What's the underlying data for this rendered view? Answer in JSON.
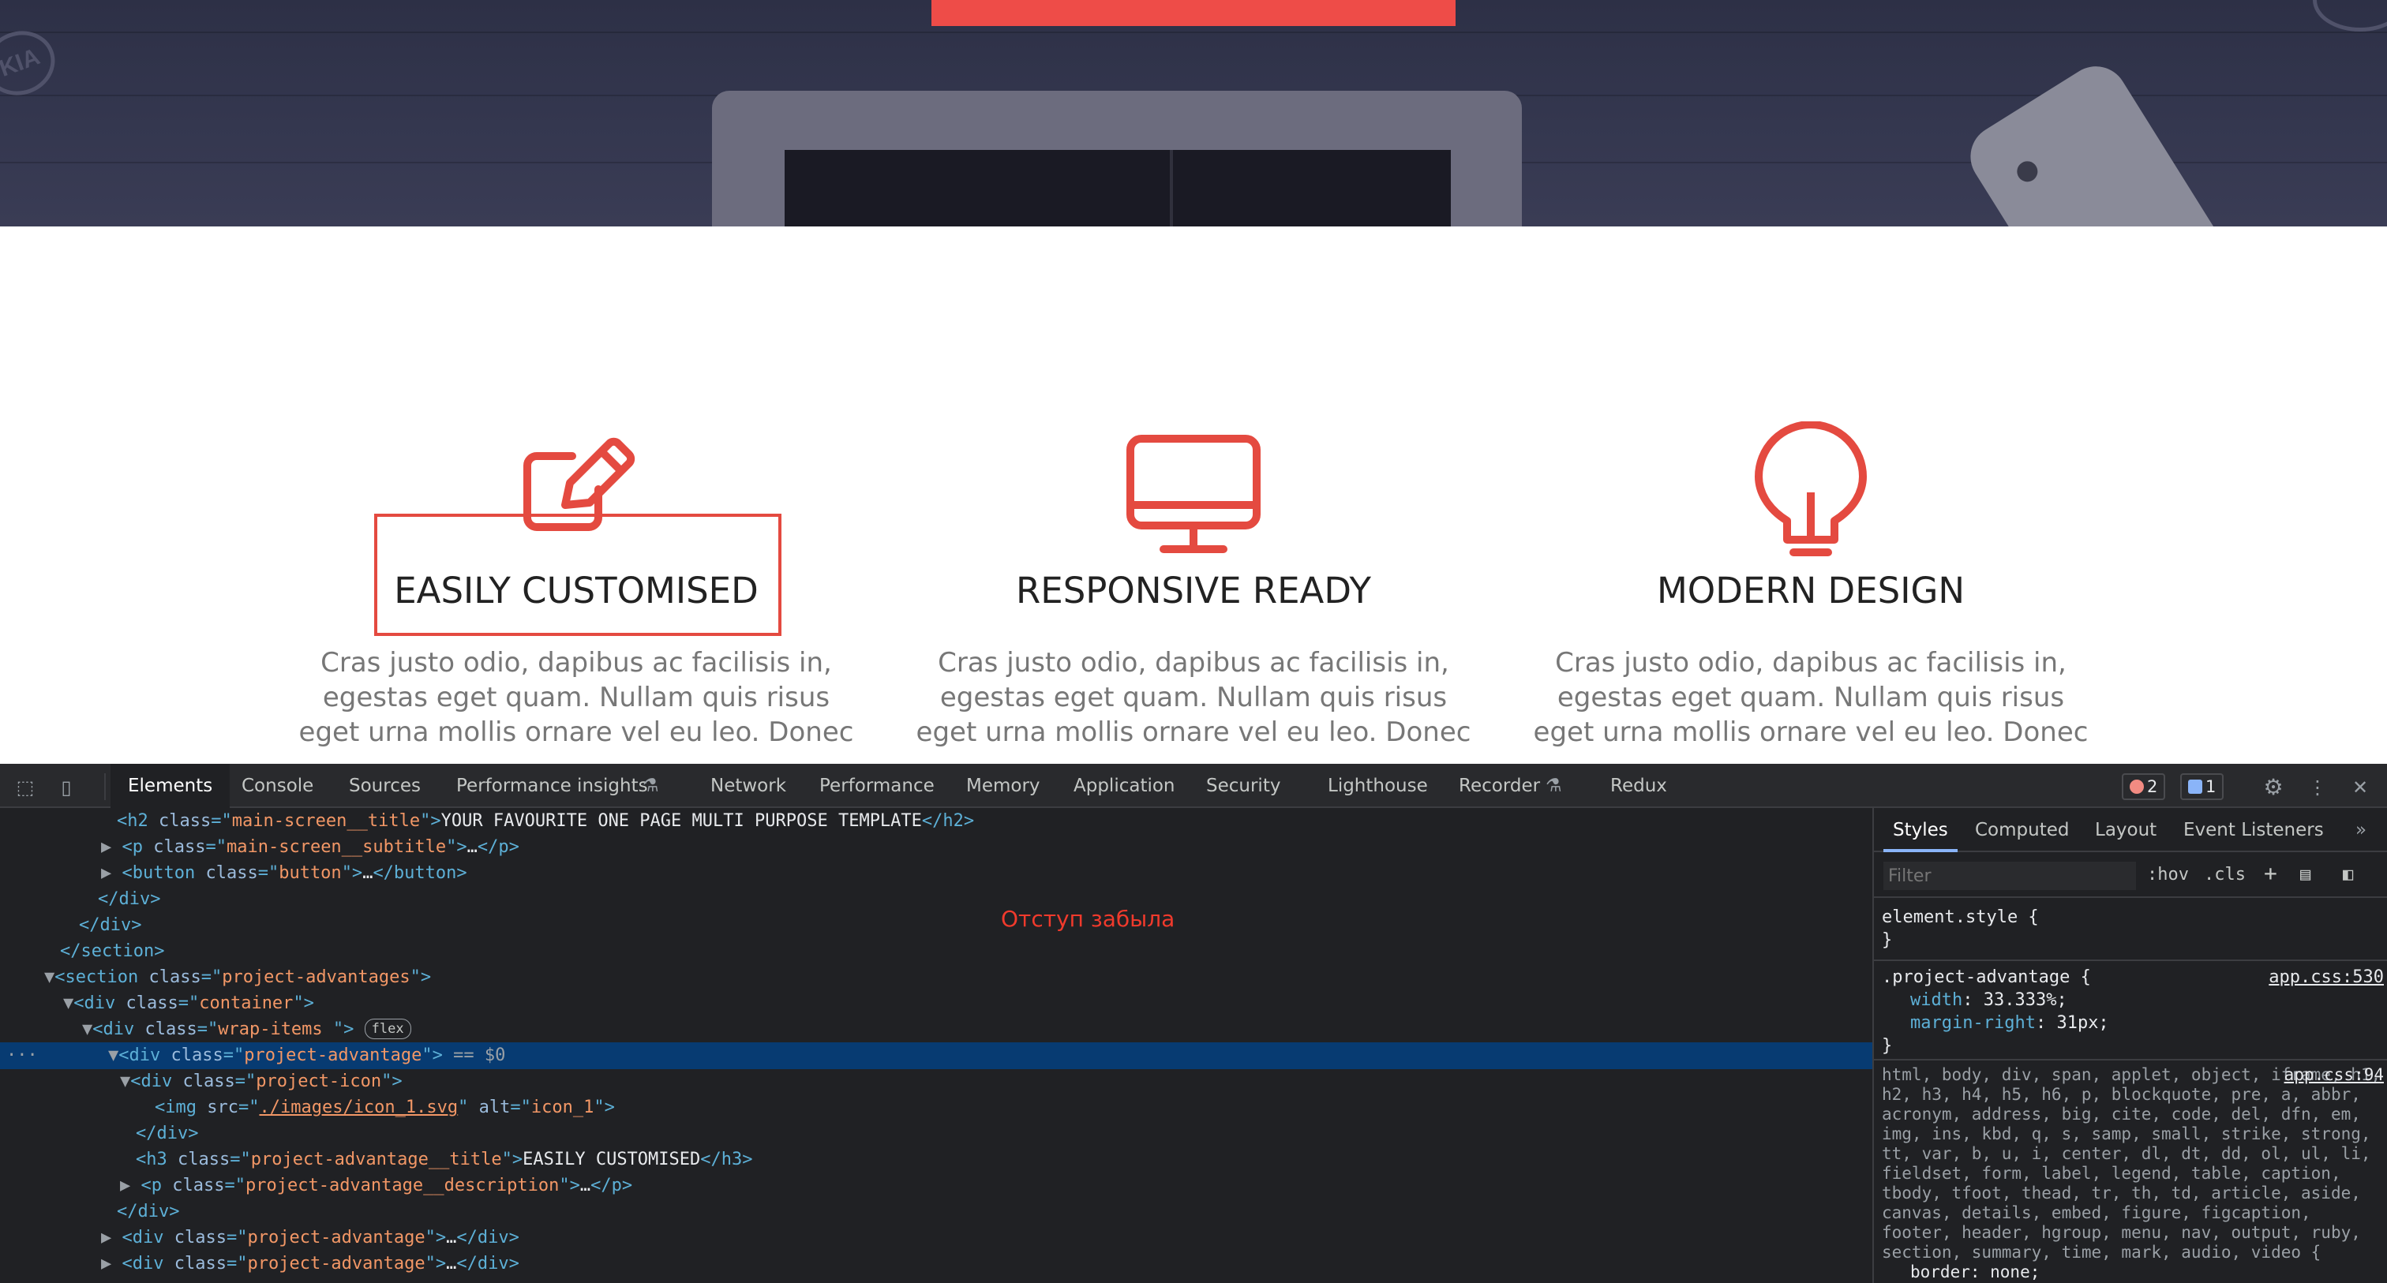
{
  "site": {
    "hero_logo_text": "KIA",
    "advantages": [
      {
        "title": "EASILY CUSTOMISED",
        "description": "Cras justo odio, dapibus ac facilisis in, egestas eget quam. Nullam quis risus eget urna mollis ornare vel eu leo. Donec",
        "icon": "edit-pencil-icon"
      },
      {
        "title": "RESPONSIVE READY",
        "description": "Cras justo odio, dapibus ac facilisis in, egestas eget quam. Nullam quis risus eget urna mollis ornare vel eu leo. Donec",
        "icon": "monitor-icon"
      },
      {
        "title": "MODERN DESIGN",
        "description": "Cras justo odio, dapibus ac facilisis in, egestas eget quam. Nullam quis risus eget urna mollis ornare vel eu leo. Donec",
        "icon": "lightbulb-icon"
      }
    ],
    "accent_color": "#e44a40"
  },
  "devtools": {
    "tabs": [
      "Elements",
      "Console",
      "Sources",
      "Performance insights",
      "Network",
      "Performance",
      "Memory",
      "Application",
      "Security",
      "Lighthouse",
      "Recorder",
      "Redux"
    ],
    "active_tab": "Elements",
    "error_count": "2",
    "message_count": "1",
    "note": "Отступ забыла",
    "dom": {
      "h2_class": "main-screen__title",
      "h2_text": "YOUR FAVOURITE ONE PAGE MULTI PURPOSE TEMPLATE",
      "p_class": "main-screen__subtitle",
      "button_class": "button",
      "section_class": "project-advantages",
      "container_class": "container",
      "wrap_class": "wrap-items ",
      "flex_badge": "flex",
      "adv_class": "project-advantage",
      "selected_marker": "== $0",
      "icon_class": "project-icon",
      "img_src": "./images/icon_1.svg",
      "img_alt": "icon_1",
      "h3_class": "project-advantage__title",
      "h3_text": "EASILY CUSTOMISED",
      "desc_class": "project-advantage__description",
      "ellipsis": "…"
    },
    "styles": {
      "tabs": [
        "Styles",
        "Computed",
        "Layout",
        "Event Listeners"
      ],
      "active_tab": "Styles",
      "filter_placeholder": "Filter",
      "hov": ":hov",
      "cls": ".cls",
      "element_style": "element.style {",
      "rule1_selector": ".project-advantage {",
      "rule1_source": "app.css:530",
      "rule1_props": [
        {
          "name": "width",
          "value": "33.333%;"
        },
        {
          "name": "margin-right",
          "value": "31px;"
        }
      ],
      "rule2_source": "app.css:94",
      "rule2_selectors": "html, body, div, span, applet, object, iframe, h1, h2, h3, h4, h5, h6, p, blockquote, pre, a, abbr, acronym, address, big, cite, code, del, dfn, em, img, ins, kbd, q, s, samp, small, strike, strong, tt, var, b, u, i, center, dl, dt, dd, ol, ul, li, fieldset, form, label, legend, table, caption, tbody, tfoot, thead, tr, th, td, article, aside, canvas, details, embed, figure, figcaption, footer, header, hgroup, menu, nav, output, ruby, section, summary, time, mark, audio, video {",
      "rule2_prop_partial": "border: none;"
    }
  }
}
